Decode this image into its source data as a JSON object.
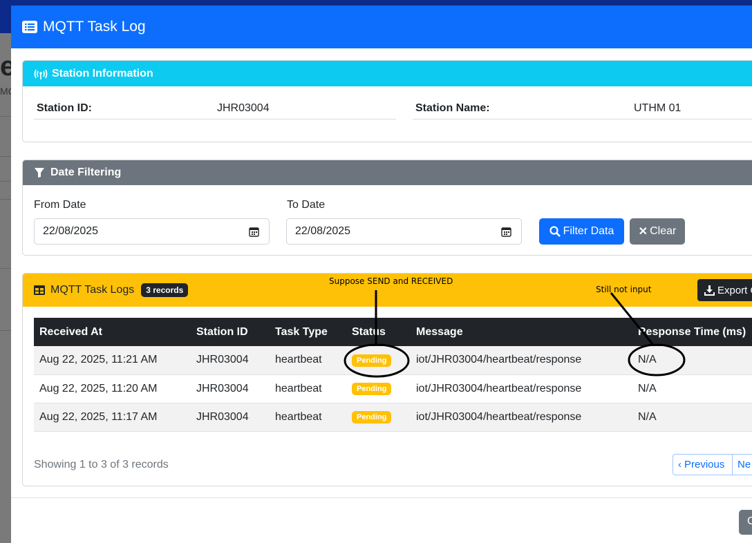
{
  "modal": {
    "title": "MQTT Task Log"
  },
  "station_info": {
    "header": "Station Information",
    "station_id_label": "Station ID:",
    "station_id_value": "JHR03004",
    "station_name_label": "Station Name:",
    "station_name_value": "UTHM 01"
  },
  "date_filtering": {
    "header": "Date Filtering",
    "from_label": "From Date",
    "from_value": "22/08/2025",
    "to_label": "To Date",
    "to_value": "22/08/2025",
    "filter_button": "Filter Data",
    "clear_button": "Clear"
  },
  "logs": {
    "header": "MQTT Task Logs",
    "badge": "3 records",
    "export_button": "Export C",
    "columns": [
      "Received At",
      "Station ID",
      "Task Type",
      "Status",
      "Message",
      "Response Time (ms)"
    ],
    "rows": [
      {
        "received_at": "Aug 22, 2025, 11:21 AM",
        "station_id": "JHR03004",
        "task_type": "heartbeat",
        "status": "Pending",
        "message": "iot/JHR03004/heartbeat/response",
        "response_time": "N/A"
      },
      {
        "received_at": "Aug 22, 2025, 11:20 AM",
        "station_id": "JHR03004",
        "task_type": "heartbeat",
        "status": "Pending",
        "message": "iot/JHR03004/heartbeat/response",
        "response_time": "N/A"
      },
      {
        "received_at": "Aug 22, 2025, 11:17 AM",
        "station_id": "JHR03004",
        "task_type": "heartbeat",
        "status": "Pending",
        "message": "iot/JHR03004/heartbeat/response",
        "response_time": "N/A"
      }
    ],
    "showing": "Showing 1 to 3 of 3 records",
    "prev_label": "Previous",
    "next_label": "Ne"
  },
  "background": {
    "heading_fragment": "e",
    "sub_fragment": "MQ"
  },
  "annotations": {
    "status_note": "Suppose SEND and RECEIVED",
    "response_note": "Still not input"
  },
  "footer": {
    "button_fragment": "C"
  },
  "colors": {
    "primary": "#0d6efd",
    "info": "#0dcaf0",
    "secondary": "#6c757d",
    "warning": "#ffc107",
    "dark": "#212529"
  },
  "icons": {
    "title": "list-icon",
    "station": "broadcast-icon",
    "filter": "funnel-icon",
    "calendar": "calendar-icon",
    "search": "search-icon",
    "clear": "x-icon",
    "table": "table-icon",
    "export": "download-icon",
    "prev": "chevron-left-icon"
  }
}
